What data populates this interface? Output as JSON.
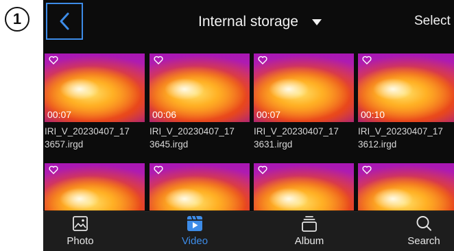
{
  "step_marker": "1",
  "header": {
    "storage_title": "Internal storage",
    "select_label": "Select",
    "back_icon": "chevron-left-icon",
    "dropdown_icon": "triangle-down-icon"
  },
  "files": [
    {
      "duration": "00:07",
      "name_line1": "IRI_V_20230407_17",
      "name_line2": "3657.irgd"
    },
    {
      "duration": "00:06",
      "name_line1": "IRI_V_20230407_17",
      "name_line2": "3645.irgd"
    },
    {
      "duration": "00:07",
      "name_line1": "IRI_V_20230407_17",
      "name_line2": "3631.irgd"
    },
    {
      "duration": "00:10",
      "name_line1": "IRI_V_20230407_17",
      "name_line2": "3612.irgd"
    },
    {
      "duration": "",
      "name_line1": "",
      "name_line2": ""
    },
    {
      "duration": "",
      "name_line1": "",
      "name_line2": ""
    },
    {
      "duration": "",
      "name_line1": "",
      "name_line2": ""
    },
    {
      "duration": "",
      "name_line1": "",
      "name_line2": ""
    }
  ],
  "bottom_nav": [
    {
      "label": "Photo",
      "icon": "image-icon",
      "active": false
    },
    {
      "label": "Video",
      "icon": "video-icon",
      "active": true
    },
    {
      "label": "Album",
      "icon": "album-icon",
      "active": false
    },
    {
      "label": "Search",
      "icon": "search-icon",
      "active": false
    }
  ],
  "colors": {
    "accent": "#3d8ce8",
    "background": "#0c0c0c",
    "bottom_bar": "#1d1d1d",
    "text": "#f2f2f2"
  }
}
